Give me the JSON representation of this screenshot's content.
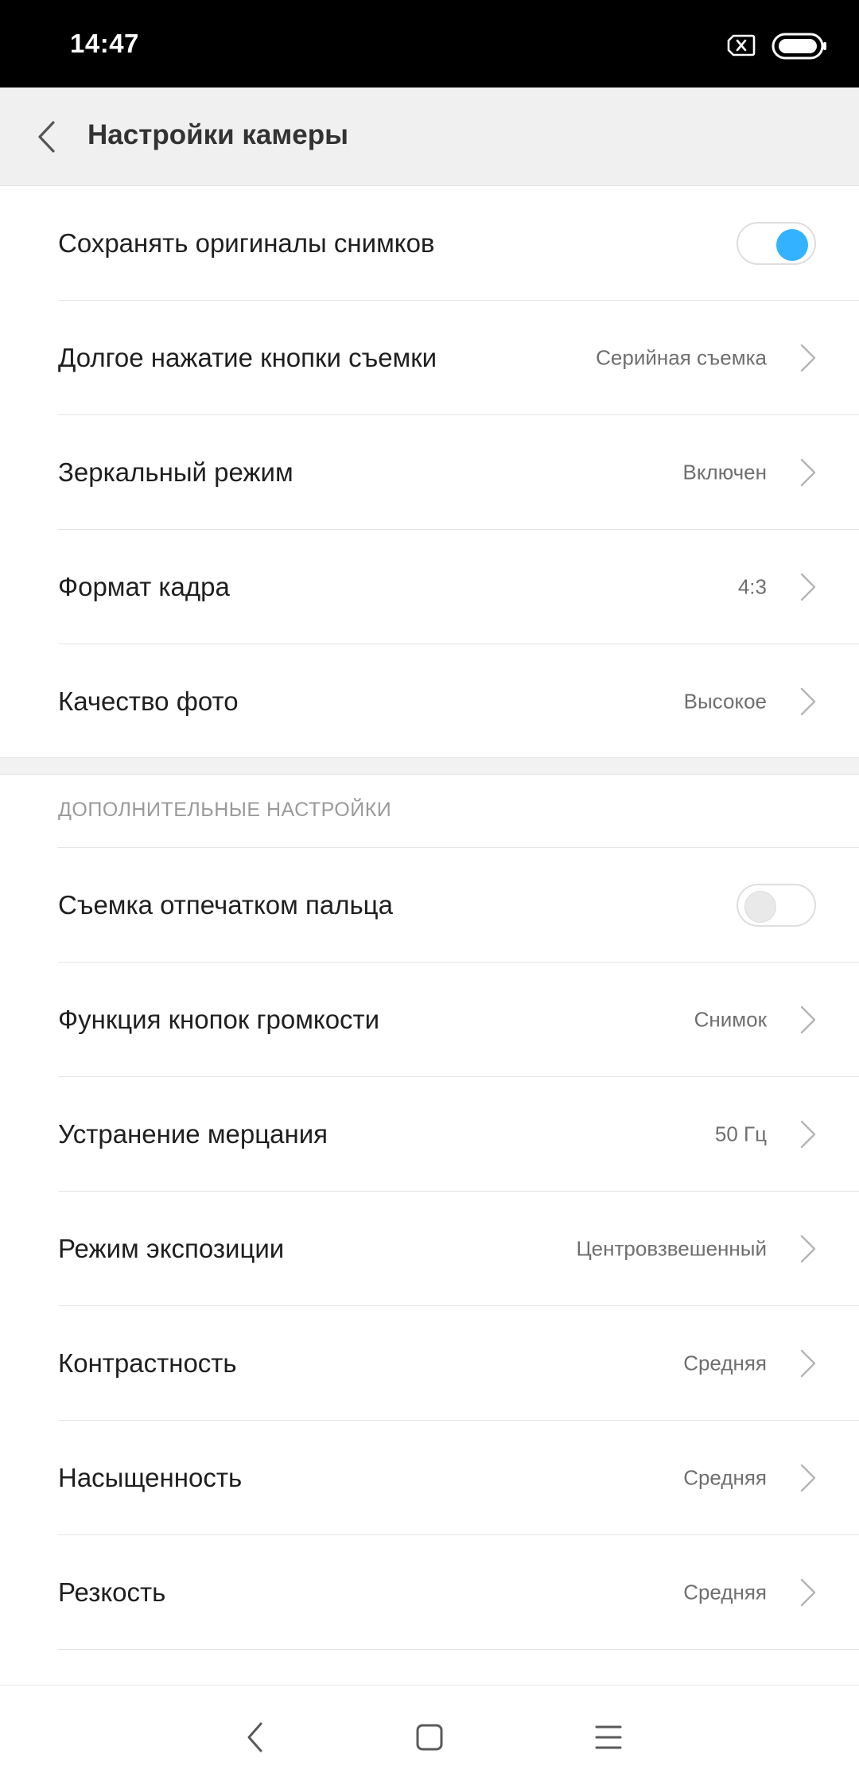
{
  "status_bar": {
    "time": "14:47",
    "icons": [
      "sim-absent-icon",
      "battery-icon"
    ]
  },
  "app_bar": {
    "back_icon": "back-chevron-icon",
    "title": "Настройки камеры"
  },
  "colors": {
    "accent": "#33b3ff",
    "status_bar_bg": "#000000",
    "app_bar_bg": "#f0f0f0"
  },
  "main_settings": [
    {
      "label": "Сохранять оригиналы снимков",
      "type": "toggle",
      "checked": true
    },
    {
      "label": "Долгое нажатие кнопки съемки",
      "type": "link",
      "value": "Серийная съемка"
    },
    {
      "label": "Зеркальный режим",
      "type": "link",
      "value": "Включен"
    },
    {
      "label": "Формат кадра",
      "type": "link",
      "value": "4:3"
    },
    {
      "label": "Качество фото",
      "type": "link",
      "value": "Высокое"
    }
  ],
  "advanced": {
    "header": "ДОПОЛНИТЕЛЬНЫЕ НАСТРОЙКИ",
    "items": [
      {
        "label": "Съемка отпечатком пальца",
        "type": "toggle",
        "checked": false
      },
      {
        "label": "Функция кнопок громкости",
        "type": "link",
        "value": "Снимок"
      },
      {
        "label": "Устранение мерцания",
        "type": "link",
        "value": "50 Гц"
      },
      {
        "label": "Режим экспозиции",
        "type": "link",
        "value": "Центровзвешенный"
      },
      {
        "label": "Контрастность",
        "type": "link",
        "value": "Средняя"
      },
      {
        "label": "Насыщенность",
        "type": "link",
        "value": "Средняя"
      },
      {
        "label": "Резкость",
        "type": "link",
        "value": "Средняя"
      }
    ]
  },
  "nav_bar": {
    "icons": [
      "nav-back-icon",
      "nav-home-icon",
      "nav-menu-icon"
    ]
  }
}
